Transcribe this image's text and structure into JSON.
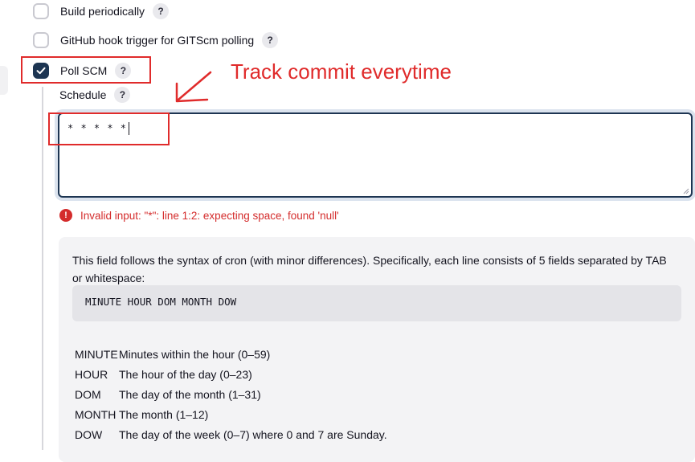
{
  "triggers": [
    {
      "label": "Build periodically",
      "checked": false,
      "help": "?"
    },
    {
      "label": "GitHub hook trigger for GITScm polling",
      "checked": false,
      "help": "?"
    },
    {
      "label": "Poll SCM",
      "checked": true,
      "help": "?"
    }
  ],
  "schedule": {
    "label": "Schedule",
    "help": "?",
    "value": "* * * * *"
  },
  "error": {
    "icon": "!",
    "message": "Invalid input: \"*\": line 1:2: expecting space, found 'null'"
  },
  "help_panel": {
    "intro": "This field follows the syntax of cron (with minor differences). Specifically, each line consists of 5 fields separated by TAB or whitespace:",
    "code": "MINUTE HOUR DOM MONTH DOW",
    "fields": [
      {
        "name": "MINUTE",
        "desc": "Minutes within the hour (0–59)"
      },
      {
        "name": "HOUR",
        "desc": "The hour of the day (0–23)"
      },
      {
        "name": "DOM",
        "desc": "The day of the month (1–31)"
      },
      {
        "name": "MONTH",
        "desc": "The month (1–12)"
      },
      {
        "name": "DOW",
        "desc": "The day of the week (0–7) where 0 and 7 are Sunday."
      }
    ]
  },
  "annotation": {
    "text": "Track commit everytime",
    "color": "#e02b2b"
  },
  "colors": {
    "checkbox_checked": "#1d3552",
    "error": "#d42c2c"
  }
}
